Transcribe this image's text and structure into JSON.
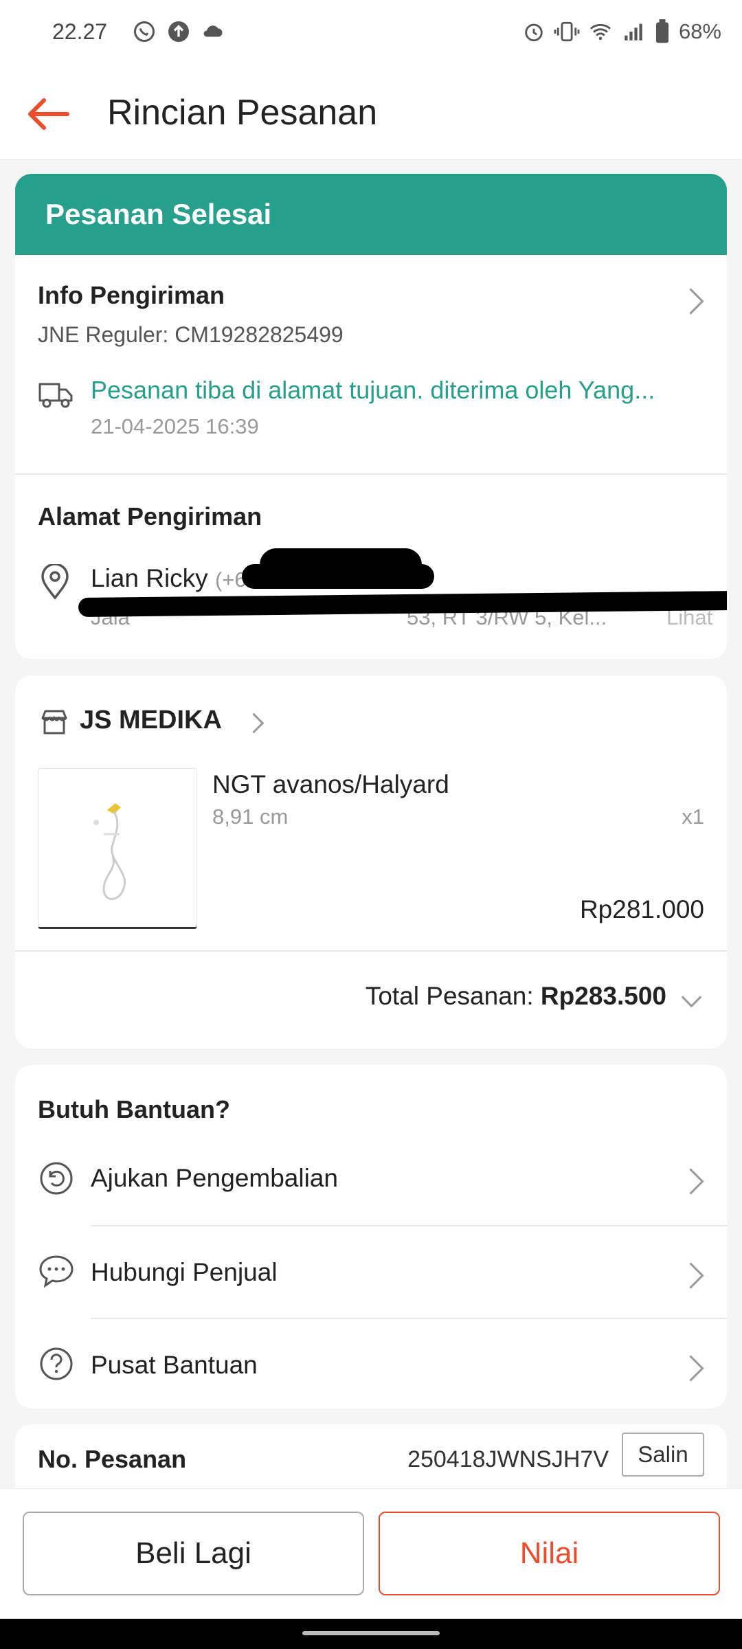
{
  "status_bar": {
    "time": "22.27",
    "battery": "68%"
  },
  "header": {
    "title": "Rincian Pesanan"
  },
  "order_status": {
    "label": "Pesanan Selesai",
    "color": "#26a08c"
  },
  "shipping_info": {
    "title": "Info Pengiriman",
    "courier": "JNE Reguler: CM19282825499",
    "latest_status": "Pesanan tiba di alamat tujuan. diterima oleh Yang...",
    "timestamp": "21-04-2025 16:39"
  },
  "shipping_address": {
    "title": "Alamat Pengiriman",
    "name": "Lian Ricky",
    "phone_prefix": "(+62",
    "address_partial": "Jala",
    "address_tail": "53, RT 3/RW 5, Kel...",
    "more_label": "Lihat"
  },
  "store": {
    "name": "JS MEDIKA",
    "product": {
      "name": "NGT avanos/Halyard",
      "variant": "8,91 cm",
      "qty": "x1",
      "price": "Rp281.000"
    },
    "total_label": "Total Pesanan: ",
    "total_value": "Rp283.500"
  },
  "help": {
    "title": "Butuh Bantuan?",
    "items": [
      {
        "label": "Ajukan Pengembalian",
        "icon": "return-icon"
      },
      {
        "label": "Hubungi Penjual",
        "icon": "chat-icon"
      },
      {
        "label": "Pusat Bantuan",
        "icon": "help-icon"
      }
    ]
  },
  "order_number": {
    "label": "No. Pesanan",
    "value": "250418JWNSJH7V",
    "copy_label": "Salin"
  },
  "actions": {
    "buy_again": "Beli Lagi",
    "rate": "Nilai"
  },
  "colors": {
    "accent": "#ee4d2d",
    "teal": "#26a08c"
  }
}
